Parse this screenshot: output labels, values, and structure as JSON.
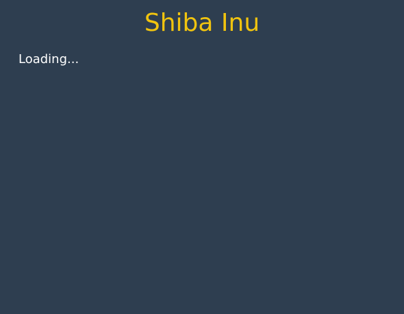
{
  "header": {
    "title": "Shiba Inu"
  },
  "main": {
    "status_text": "Loading..."
  },
  "colors": {
    "background": "#2e3e50",
    "title": "#f1c40f",
    "status_text": "#ffffff"
  }
}
